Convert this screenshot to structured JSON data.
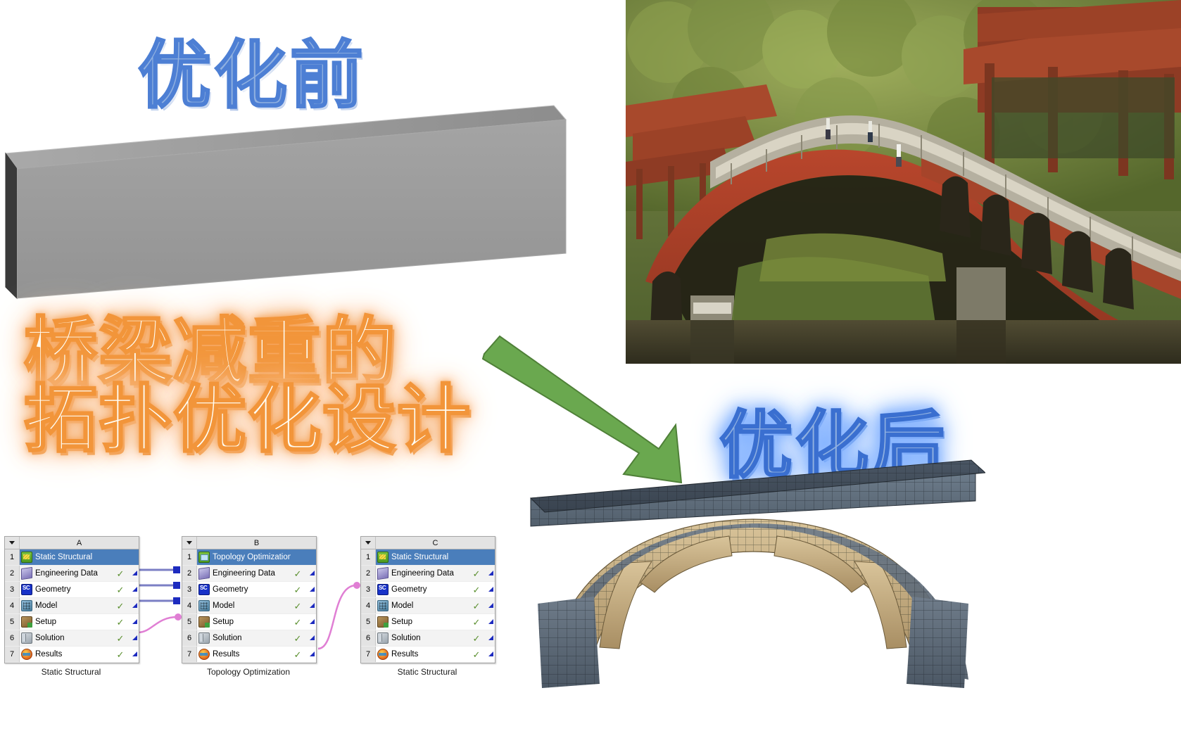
{
  "slide": {
    "label_before": "优化前",
    "label_after": "优化后",
    "main_title_line1": "桥梁减重的",
    "main_title_line2": "拓扑优化设计"
  },
  "colors": {
    "label_blue_fill": "#8fb0e0",
    "label_blue_stroke": "#4d7fd4",
    "title_fill": "#fffdf4",
    "title_stroke": "#f2953a",
    "arrow_green": "#6aa game"
  },
  "arrow": {
    "name": "optimization-arrow",
    "direction": "down-right",
    "color": "#6aa84f"
  },
  "beam": {
    "name": "unoptimized-solid-beam",
    "color": "#9b9b9b"
  },
  "photo": {
    "name": "chinese-arch-bridge-photo",
    "subject": "红色中式拱桥"
  },
  "fem": {
    "name": "optimized-bridge-fem-model",
    "deck_color": "#5d6a78",
    "body_color": "#c3a97e"
  },
  "workflow": {
    "columns": [
      {
        "column_letter": "A",
        "caption": "Static Structural",
        "rows": [
          {
            "num": "1",
            "label": "Static Structural",
            "icon": "static-structural-icon",
            "status": "",
            "corner": false
          },
          {
            "num": "2",
            "label": "Engineering Data",
            "icon": "engineering-data-icon",
            "status": "✓",
            "corner": true
          },
          {
            "num": "3",
            "label": "Geometry",
            "icon": "geometry-spaceclaim-icon",
            "status": "✓",
            "corner": true
          },
          {
            "num": "4",
            "label": "Model",
            "icon": "model-icon",
            "status": "✓",
            "corner": true
          },
          {
            "num": "5",
            "label": "Setup",
            "icon": "setup-icon",
            "status": "✓",
            "corner": true
          },
          {
            "num": "6",
            "label": "Solution",
            "icon": "solution-icon",
            "status": "✓",
            "corner": true
          },
          {
            "num": "7",
            "label": "Results",
            "icon": "results-icon",
            "status": "✓",
            "corner": true
          }
        ]
      },
      {
        "column_letter": "B",
        "caption": "Topology Optimization",
        "rows": [
          {
            "num": "1",
            "label": "Topology Optimization",
            "icon": "topology-optimization-icon",
            "status": "",
            "corner": false
          },
          {
            "num": "2",
            "label": "Engineering Data",
            "icon": "engineering-data-icon",
            "status": "✓",
            "corner": true
          },
          {
            "num": "3",
            "label": "Geometry",
            "icon": "geometry-spaceclaim-icon",
            "status": "✓",
            "corner": true
          },
          {
            "num": "4",
            "label": "Model",
            "icon": "model-icon",
            "status": "✓",
            "corner": true
          },
          {
            "num": "5",
            "label": "Setup",
            "icon": "setup-icon",
            "status": "✓",
            "corner": true
          },
          {
            "num": "6",
            "label": "Solution",
            "icon": "solution-icon",
            "status": "✓",
            "corner": true
          },
          {
            "num": "7",
            "label": "Results",
            "icon": "results-icon",
            "status": "✓",
            "corner": true
          }
        ]
      },
      {
        "column_letter": "C",
        "caption": "Static Structural",
        "rows": [
          {
            "num": "1",
            "label": "Static Structural",
            "icon": "static-structural-icon",
            "status": "",
            "corner": false
          },
          {
            "num": "2",
            "label": "Engineering Data",
            "icon": "engineering-data-icon",
            "status": "✓",
            "corner": true
          },
          {
            "num": "3",
            "label": "Geometry",
            "icon": "geometry-spaceclaim-icon",
            "status": "✓",
            "corner": true
          },
          {
            "num": "4",
            "label": "Model",
            "icon": "model-icon",
            "status": "✓",
            "corner": true
          },
          {
            "num": "5",
            "label": "Setup",
            "icon": "setup-icon",
            "status": "✓",
            "corner": true
          },
          {
            "num": "6",
            "label": "Solution",
            "icon": "solution-icon",
            "status": "✓",
            "corner": true
          },
          {
            "num": "7",
            "label": "Results",
            "icon": "results-icon",
            "status": "✓",
            "corner": true
          }
        ]
      }
    ],
    "link_colors": {
      "data_share": "#7b7fc4",
      "data_transfer": "#e07fd4"
    }
  }
}
